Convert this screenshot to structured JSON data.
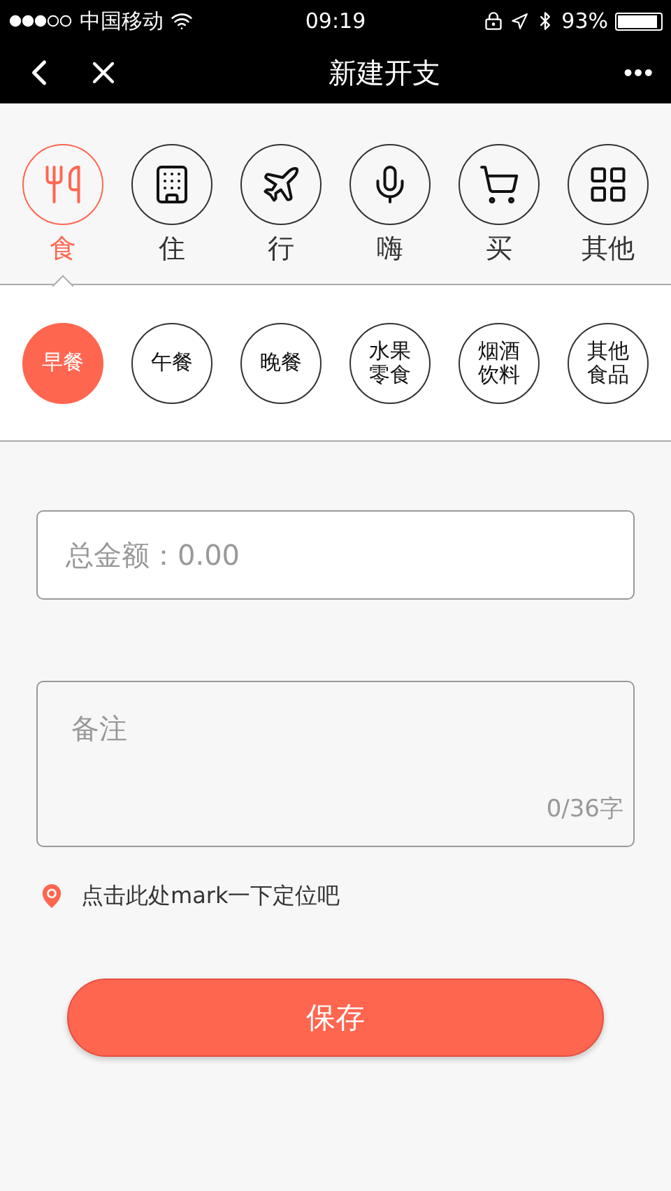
{
  "status_bar": {
    "carrier": "中国移动",
    "time": "09:19",
    "battery": "93%"
  },
  "nav": {
    "title": "新建开支",
    "more": "•••"
  },
  "categories": [
    {
      "label": "食",
      "kind": "food",
      "selected": true
    },
    {
      "label": "住",
      "kind": "housing",
      "selected": false
    },
    {
      "label": "行",
      "kind": "travel",
      "selected": false
    },
    {
      "label": "嗨",
      "kind": "fun",
      "selected": false
    },
    {
      "label": "买",
      "kind": "shopping",
      "selected": false
    },
    {
      "label": "其他",
      "kind": "other",
      "selected": false
    }
  ],
  "subcategories": [
    {
      "label": "早餐",
      "selected": true
    },
    {
      "label": "午餐",
      "selected": false
    },
    {
      "label": "晚餐",
      "selected": false
    },
    {
      "label": "水果零食",
      "selected": false
    },
    {
      "label": "烟酒饮料",
      "selected": false
    },
    {
      "label": "其他食品",
      "selected": false
    }
  ],
  "amount": {
    "placeholder": "总金额：0.00"
  },
  "note": {
    "placeholder": "备注",
    "counter": "0/36字"
  },
  "location": {
    "text": "点击此处mark一下定位吧"
  },
  "save_button": "保存"
}
